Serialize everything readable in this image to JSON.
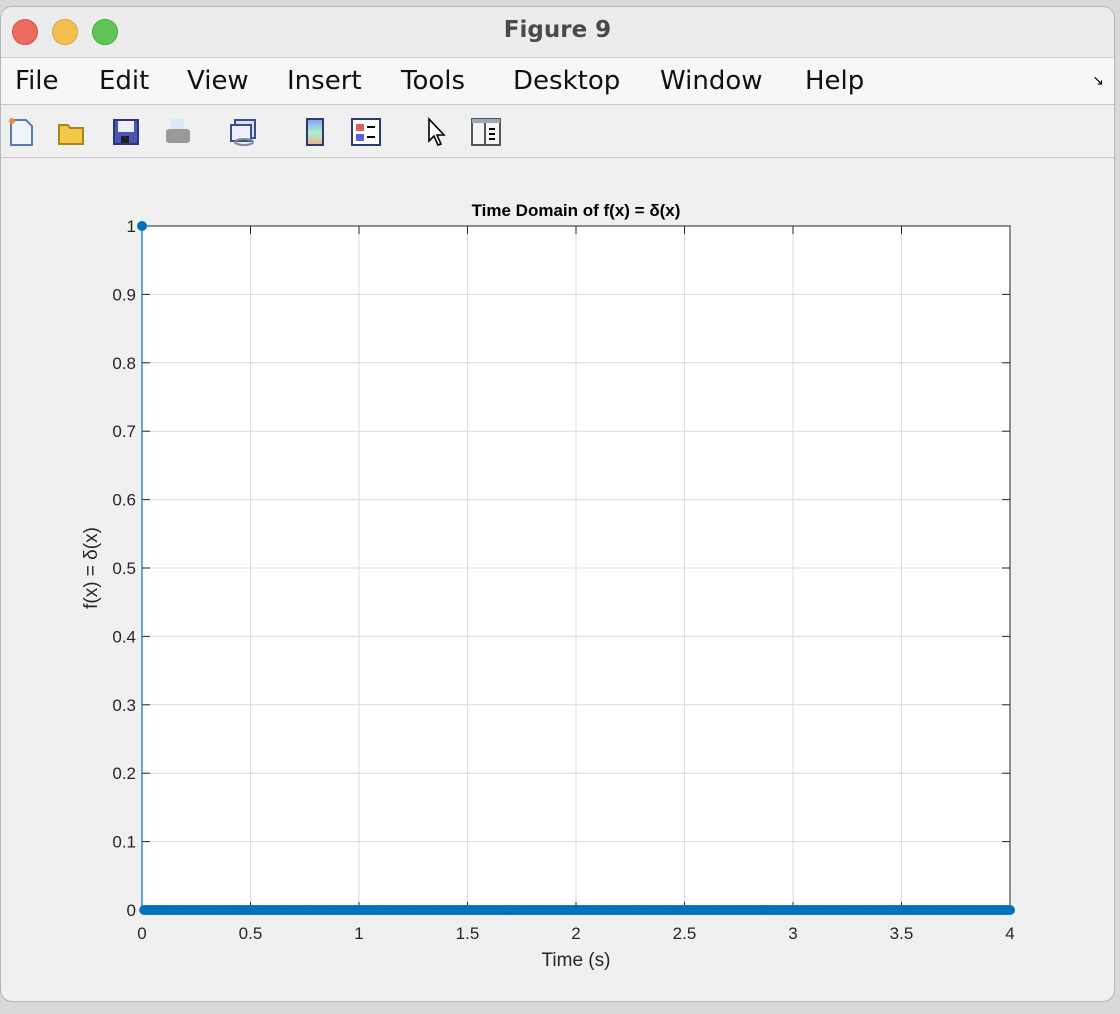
{
  "window": {
    "title": "Figure 9"
  },
  "menu": [
    "File",
    "Edit",
    "View",
    "Insert",
    "Tools",
    "Desktop",
    "Window",
    "Help"
  ],
  "toolbar": [
    "new-figure-icon",
    "open-file-icon",
    "save-icon",
    "print-icon",
    "link-plot-icon",
    "colorbar-icon",
    "legend-icon",
    "edit-plot-pointer-icon",
    "property-inspector-icon"
  ],
  "chart_data": {
    "type": "stem",
    "title": "Time Domain of f(x) = δ(x)",
    "xlabel": "Time (s)",
    "ylabel": "f(x) = δ(x)",
    "xlim": [
      0,
      4
    ],
    "ylim": [
      0,
      1
    ],
    "xticks": [
      "0",
      "0.5",
      "1",
      "1.5",
      "2",
      "2.5",
      "3",
      "3.5",
      "4"
    ],
    "yticks": [
      "0",
      "0.1",
      "0.2",
      "0.3",
      "0.4",
      "0.5",
      "0.6",
      "0.7",
      "0.8",
      "0.9",
      "1"
    ],
    "grid": true,
    "series": [
      {
        "name": "f(x)",
        "color": "#0072bd",
        "x_start": 0,
        "x_end": 4,
        "x_step": 0.01,
        "default_value": 0,
        "impulses": [
          {
            "x": 0,
            "y": 1
          }
        ]
      }
    ]
  }
}
